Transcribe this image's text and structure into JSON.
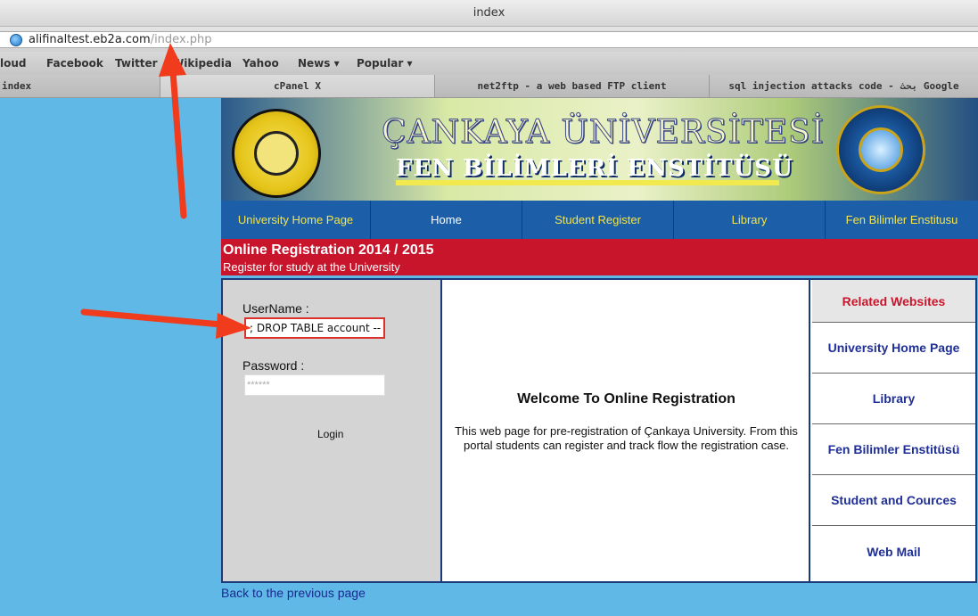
{
  "browser": {
    "window_title": "index",
    "url_host": "alifinaltest.eb2a.com",
    "url_path": "/index.php",
    "bookmarks": [
      "loud",
      "Facebook",
      "Twitter",
      "Wikipedia",
      "Yahoo",
      "News ▾",
      "Popular ▾"
    ],
    "tabs": [
      "index",
      "cPanel X",
      "net2ftp - a web based FTP client",
      "sql injection attacks code - بحث Google"
    ]
  },
  "banner": {
    "title_line1": "ÇANKAYA ÜNİVERSİTESİ",
    "title_line2": "FEN BİLİMLERİ ENSTİTÜSÜ"
  },
  "nav": {
    "items": [
      "University Home Page",
      "Home",
      "Student Register",
      "Library",
      "Fen Bilimler Enstitusu"
    ]
  },
  "registration": {
    "title": "Online Registration 2014 / 2015",
    "subtitle": "Register for study at the University"
  },
  "login": {
    "username_label": "UserName :",
    "username_value": "; DROP TABLE account --",
    "password_label": "Password  :",
    "password_value": "******",
    "login_label": "Login"
  },
  "welcome": {
    "title": "Welcome To Online Registration",
    "text": "This web page for pre-registration of Çankaya University. From this portal students can register and track flow the registration case."
  },
  "related": {
    "heading": "Related Websites",
    "items": [
      "University Home Page",
      "Library",
      "Fen Bilimler Enstitüsü",
      "Student and Cources",
      "Web Mail"
    ]
  },
  "footer": {
    "back_link": "Back to the previous page"
  },
  "colors": {
    "page_bg": "#5fb8e6",
    "nav_bg": "#1c5fa8",
    "nav_text": "#f5e44a",
    "reg_bar": "#c8152c",
    "annotation_arrow": "#f03b1c"
  }
}
